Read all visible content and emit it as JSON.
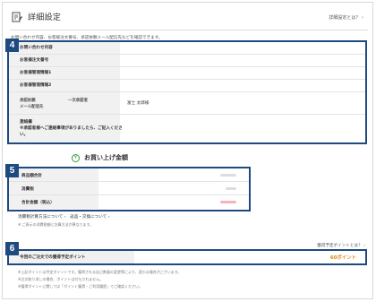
{
  "header": {
    "title": "詳細設定",
    "help_link": "詳細設定とは？"
  },
  "intro": "お問い合わせ内容、お客様注文番号、承認依頼メール配信先などを確認できます。",
  "section4": {
    "badge": "4",
    "rows": [
      {
        "label": "お問い合わせ内容",
        "value": ""
      },
      {
        "label": "お客様注文番号",
        "value": ""
      },
      {
        "label": "お客様管理情報1",
        "value": ""
      },
      {
        "label": "お客様管理情報2",
        "value": ""
      }
    ],
    "approval": {
      "label_line1": "承認依頼",
      "label_line2": "メール配信先",
      "sub_label": "一次承認者",
      "value": "富士 太郎様"
    },
    "contact": {
      "label": "連絡欄",
      "note": "※承認者様へご連絡事項がありましたら、ご記入ください。"
    }
  },
  "section5": {
    "title": "お買い上げ金額",
    "badge": "5",
    "rows": [
      {
        "label": "商品額合計"
      },
      {
        "label": "消費税"
      },
      {
        "label": "合計金額（税込）"
      }
    ],
    "link1": "消費税計算方法について",
    "link2": "返品・交換について",
    "note": "※ ご表示の消費税額と計算方法が異なります。"
  },
  "section6": {
    "badge": "6",
    "link": "獲得予定ポイントとは？",
    "label": "今回のご注文での獲得予定ポイント",
    "points": "60ポイント",
    "notes": [
      "※上記ポイントは予定ポイントです。獲得される自己数量の変更等により、変わる場合がございます。",
      "※注文取り消しの場合、ポイントは付与されません。",
      "※獲得ポイントに関しては「ポイント獲得・ご利用履歴」でご確認ください。"
    ]
  },
  "colors": {
    "accent": "#1e4a80",
    "points": "#d48a1a",
    "icon_green": "#3a9a3a"
  }
}
